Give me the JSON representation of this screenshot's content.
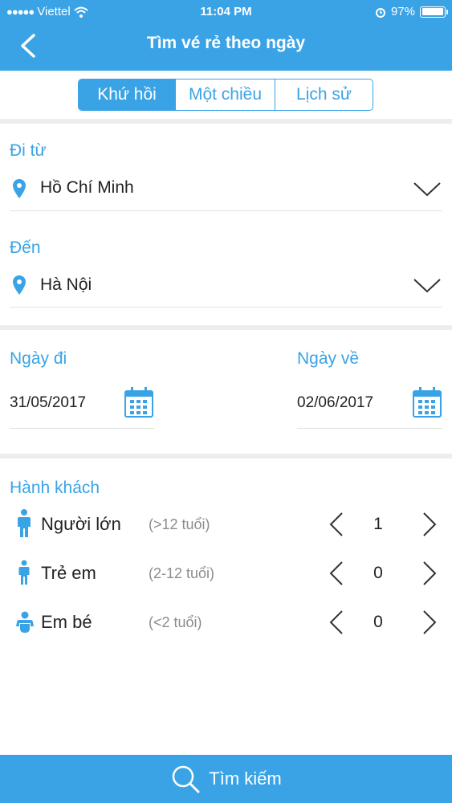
{
  "status_bar": {
    "carrier": "Viettel",
    "time": "11:04 PM",
    "battery": "97%",
    "battery_level": 0.97
  },
  "header": {
    "title": "Tìm vé rẻ theo ngày"
  },
  "tabs": [
    {
      "label": "Khứ hồi",
      "active": true
    },
    {
      "label": "Một chiều",
      "active": false
    },
    {
      "label": "Lịch sử",
      "active": false
    }
  ],
  "route": {
    "from_label": "Đi từ",
    "from_value": "Hồ Chí Minh",
    "to_label": "Đến",
    "to_value": "Hà Nội"
  },
  "dates": {
    "depart_label": "Ngày đi",
    "depart_value": "31/05/2017",
    "return_label": "Ngày về",
    "return_value": "02/06/2017"
  },
  "passengers": {
    "title": "Hành khách",
    "rows": [
      {
        "label": "Người lớn",
        "age": "(>12 tuổi)",
        "count": "1"
      },
      {
        "label": "Trẻ em",
        "age": "(2-12 tuổi)",
        "count": "0"
      },
      {
        "label": "Em bé",
        "age": "(<2 tuổi)",
        "count": "0"
      }
    ]
  },
  "search_button": {
    "label": "Tìm kiếm"
  },
  "colors": {
    "accent": "#3aa3e6",
    "divider": "#ededed",
    "muted": "#8c8c8c"
  }
}
